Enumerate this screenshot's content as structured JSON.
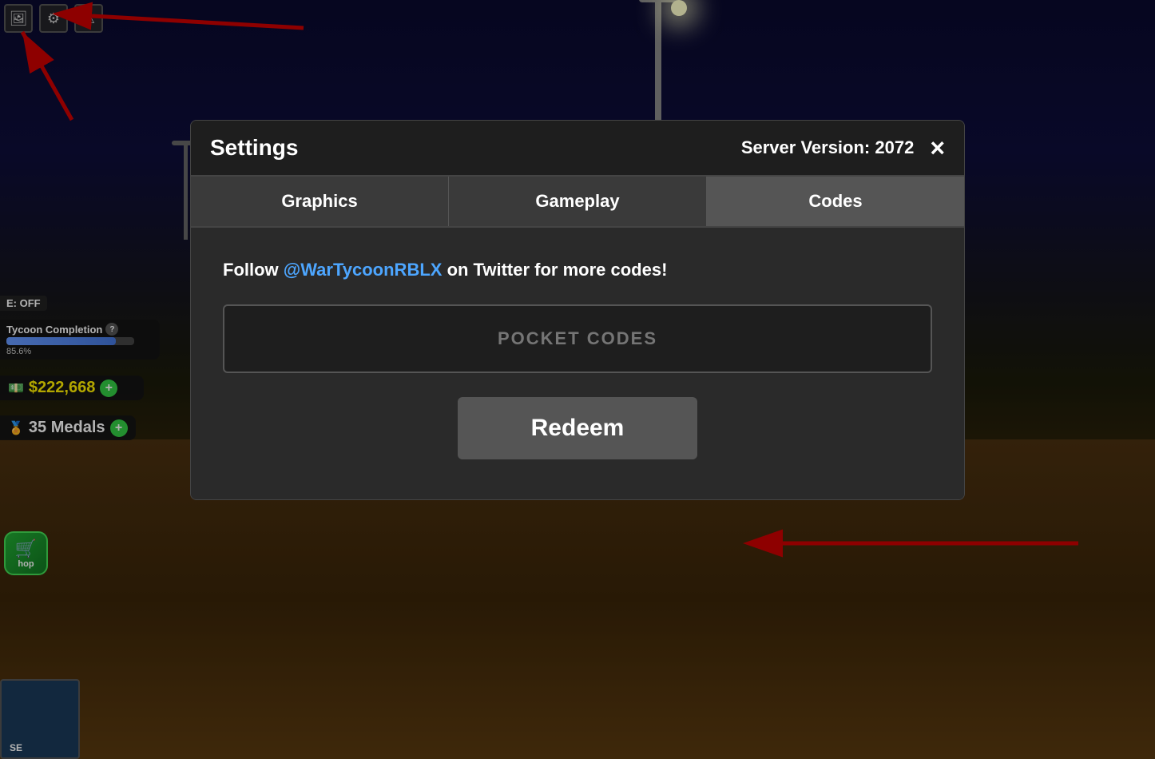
{
  "background": {
    "description": "Roblox game background - dark night scene"
  },
  "top_left_icons": [
    {
      "name": "screenshot-icon",
      "symbol": "⬜",
      "label": "screenshot"
    },
    {
      "name": "settings-gear-icon",
      "symbol": "⚙",
      "label": "settings"
    },
    {
      "name": "warning-icon",
      "symbol": "⚠",
      "label": "warning"
    }
  ],
  "hud": {
    "off_badge": "E: OFF",
    "tycoon_label": "Tycoon Completion",
    "tycoon_pct": "85.6%",
    "tycoon_progress": 85.6,
    "money_value": "$222,668",
    "medals_value": "35 Medals",
    "shop_label": "hop"
  },
  "minimap": {
    "compass": "SE"
  },
  "modal": {
    "title": "Settings",
    "server_version_label": "Server Version: 2072",
    "close_label": "×",
    "tabs": [
      {
        "label": "Graphics",
        "active": false
      },
      {
        "label": "Gameplay",
        "active": false
      },
      {
        "label": "Codes",
        "active": true
      }
    ],
    "codes": {
      "follow_text_prefix": "Follow ",
      "twitter_handle": "@WarTycoonRBLX",
      "follow_text_suffix": " on Twitter for more codes!",
      "input_placeholder": "POCKET CODES",
      "redeem_label": "Redeem"
    }
  }
}
